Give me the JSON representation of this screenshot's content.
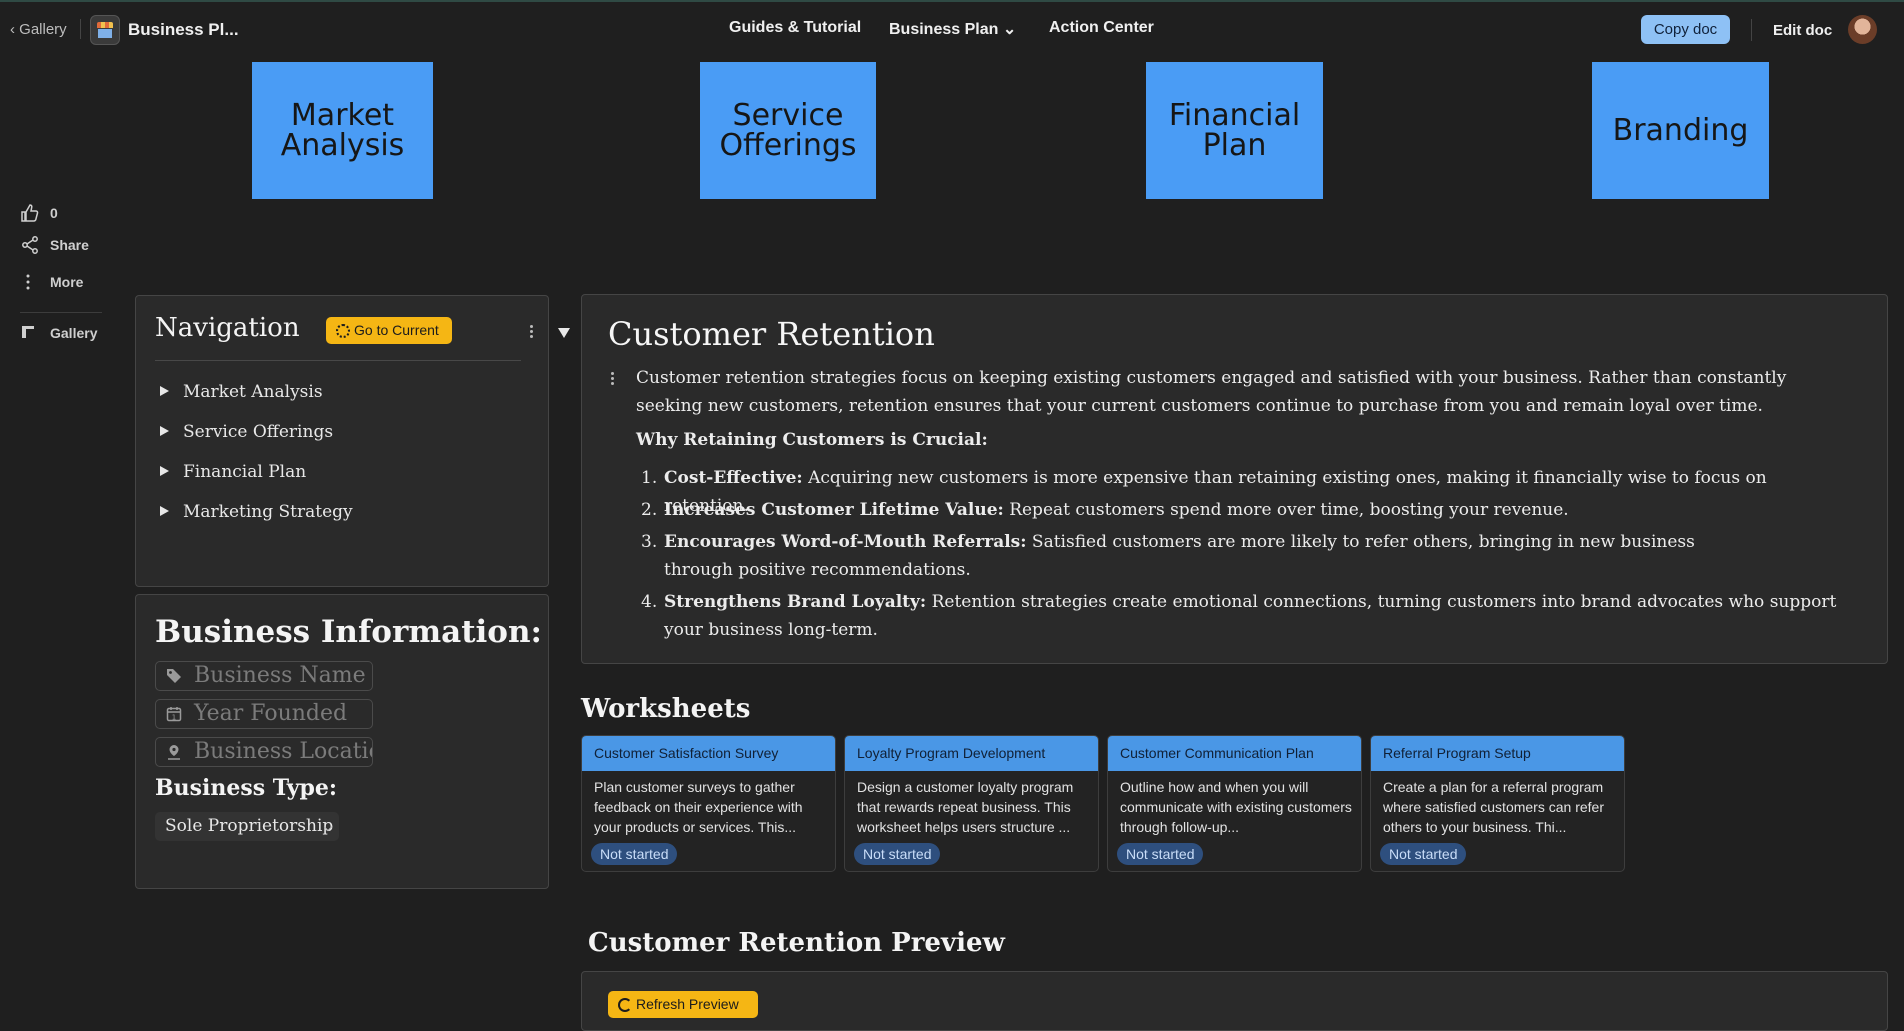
{
  "topbar": {
    "back_label": "‹ Gallery",
    "doc_title": "Business Pl...",
    "nav": [
      "Guides & Tutorial",
      "Business Plan ⌄",
      "Action Center"
    ],
    "copy_doc": "Copy doc",
    "edit_doc": "Edit doc"
  },
  "tiles": [
    "Market\nAnalysis",
    "Service\nOfferings",
    "Financial\nPlan",
    "Branding"
  ],
  "sidebar": {
    "likes": "0",
    "share": "Share",
    "more": "More",
    "gallery": "Gallery"
  },
  "navigation": {
    "title": "Navigation",
    "go_current": "Go to Current",
    "items": [
      "Market Analysis",
      "Service Offerings",
      "Financial Plan",
      "Marketing Strategy"
    ]
  },
  "business_info": {
    "title": "Business Information:",
    "name_placeholder": "Business Name",
    "year_placeholder": "Year Founded",
    "location_placeholder": "Business Location",
    "type_label": "Business Type:",
    "type_value": "Sole Proprietorship"
  },
  "retention": {
    "title": "Customer Retention",
    "intro": "Customer retention strategies focus on keeping existing customers engaged and satisfied with your business. Rather than constantly seeking new customers, retention ensures that your current customers continue to purchase from you and remain loyal over time.",
    "why": "Why Retaining Customers is Crucial:",
    "list": [
      {
        "n": "1.",
        "bold": "Cost-Effective:",
        "text": " Acquiring new customers is more expensive than retaining existing ones, making it financially wise to focus on retention."
      },
      {
        "n": "2.",
        "bold": "Increases Customer Lifetime Value:",
        "text": " Repeat customers spend more over time, boosting your revenue."
      },
      {
        "n": "3.",
        "bold": "Encourages Word-of-Mouth Referrals:",
        "text": " Satisfied customers are more likely to refer others, bringing in new business through positive recommendations."
      },
      {
        "n": "4.",
        "bold": "Strengthens Brand Loyalty:",
        "text": " Retention strategies create emotional connections, turning customers into brand advocates who support your business long-term."
      }
    ]
  },
  "worksheets": {
    "title": "Worksheets",
    "cards": [
      {
        "title": "Customer Satisfaction Survey",
        "desc": "Plan customer surveys to gather feedback on their experience with your products or services. This...",
        "status": "Not started"
      },
      {
        "title": "Loyalty Program Development",
        "desc": "Design a customer loyalty program that rewards repeat business. This worksheet helps users structure ...",
        "status": "Not started"
      },
      {
        "title": "Customer Communication Plan",
        "desc": "Outline how and when you will communicate with existing customers through follow-up...",
        "status": "Not started"
      },
      {
        "title": "Referral Program Setup",
        "desc": "Create a plan for a referral program where satisfied customers can refer others to your business. Thi...",
        "status": "Not started"
      }
    ]
  },
  "preview": {
    "title": "Customer Retention Preview",
    "refresh": "Refresh Preview"
  }
}
